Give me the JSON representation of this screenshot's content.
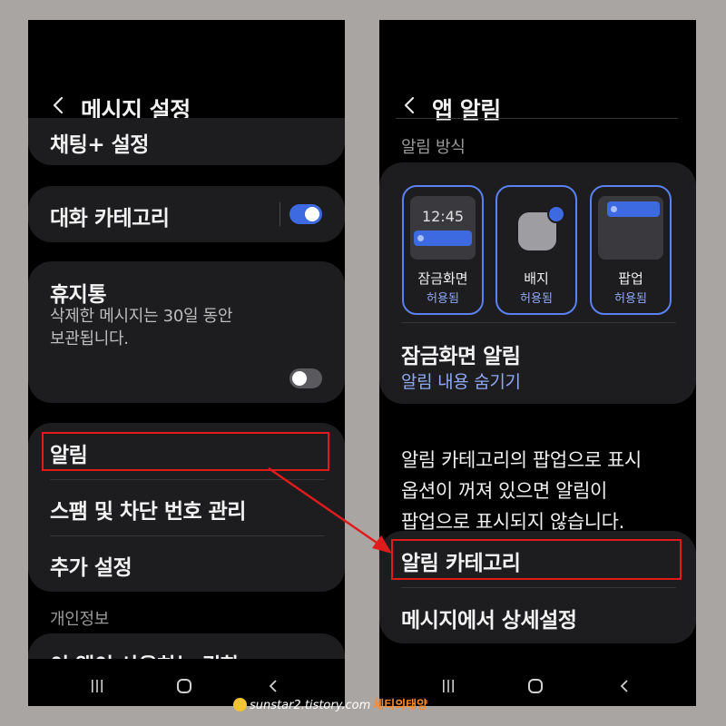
{
  "left": {
    "header": {
      "title": "메시지 설정"
    },
    "chatting_item": "채팅+ 설정",
    "conversation_categories": {
      "label": "대화 카테고리",
      "enabled": true
    },
    "trash": {
      "label": "휴지통",
      "description_line1": "삭제한 메시지는 30일 동안",
      "description_line2": "보관됩니다.",
      "enabled": false
    },
    "menu": {
      "notifications": "알림",
      "spam": "스팸 및 차단 번호 관리",
      "more": "추가 설정"
    },
    "privacy_section": "개인정보",
    "partial_item": "이 앱이 사용하는 권한"
  },
  "right": {
    "header": {
      "title": "앱 알림"
    },
    "section": "알림 방식",
    "styles": [
      {
        "label": "잠금화면",
        "status": "허용됨",
        "time": "12:45"
      },
      {
        "label": "배지",
        "status": "허용됨"
      },
      {
        "label": "팝업",
        "status": "허용됨"
      }
    ],
    "lock_screen": {
      "label": "잠금화면 알림",
      "value": "알림 내용 숨기기"
    },
    "info_line1": "알림 카테고리의 팝업으로 표시",
    "info_line2": "옵션이 꺼져 있으면 알림이",
    "info_line3": "팝업으로 표시되지 않습니다.",
    "menu": {
      "categories": "알림 카테고리",
      "advanced": "메시지에서 상세설정"
    }
  },
  "watermark": {
    "url": "sunstar2.tistory.com",
    "name": "세티의태양"
  },
  "colors": {
    "accent": "#3e6ae1",
    "highlight": "#e01b1b",
    "link": "#8fa8f5"
  }
}
